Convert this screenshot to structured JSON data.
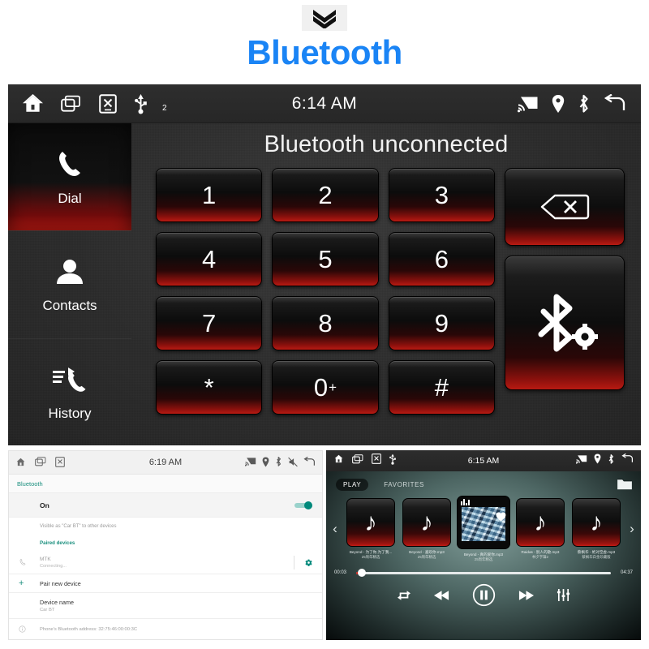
{
  "header": {
    "title": "Bluetooth",
    "chevron_icon": "double-chevron-down-icon",
    "accent_color": "#1a84f5"
  },
  "bt_screen": {
    "statusbar": {
      "time": "6:14 AM",
      "left_icons": [
        "home-icon",
        "recent-apps-icon",
        "close-box-icon",
        "usb-icon"
      ],
      "usb_badge": "2",
      "right_icons": [
        "cast-icon",
        "location-icon",
        "bluetooth-icon",
        "back-icon"
      ]
    },
    "sidebar": {
      "items": [
        {
          "label": "Dial",
          "icon": "phone-handset-icon",
          "selected": true
        },
        {
          "label": "Contacts",
          "icon": "person-icon",
          "selected": false
        },
        {
          "label": "History",
          "icon": "call-history-icon",
          "selected": false
        }
      ]
    },
    "status_text": "Bluetooth unconnected",
    "keypad": [
      {
        "key": "1"
      },
      {
        "key": "2"
      },
      {
        "key": "3"
      },
      {
        "key": "4"
      },
      {
        "key": "5"
      },
      {
        "key": "6"
      },
      {
        "key": "7"
      },
      {
        "key": "8"
      },
      {
        "key": "9"
      },
      {
        "key": "*"
      },
      {
        "key": "0",
        "sup": "+"
      },
      {
        "key": "#"
      }
    ],
    "side_keys": [
      {
        "name": "backspace",
        "icon": "backspace-icon"
      },
      {
        "name": "bluetooth-settings",
        "icon": "bluetooth-gear-icon"
      }
    ]
  },
  "settings_panel": {
    "statusbar": {
      "time": "6:19 AM",
      "left_icons": [
        "home-icon",
        "recent-apps-icon",
        "close-box-icon"
      ],
      "right_icons": [
        "cast-icon",
        "location-icon",
        "bluetooth-icon",
        "mute-icon",
        "back-icon"
      ]
    },
    "title": "Bluetooth",
    "accent_color": "#1a8f7e",
    "toggle_label": "On",
    "toggle_on": true,
    "visible_text": "Visible as \"Car BT\" to other devices",
    "paired_header": "Paired devices",
    "paired_device": {
      "name": "MTK",
      "status": "Connecting...",
      "icon": "phone-handset-icon",
      "gear": "gear-icon"
    },
    "pair_new": "Pair new device",
    "device_name_label": "Device name",
    "device_name_value": "Car BT",
    "address_text": "Phone's Bluetooth address: 32:75:46:00:00:3C"
  },
  "music_panel": {
    "statusbar": {
      "time": "6:15 AM",
      "left_icons": [
        "home-icon",
        "recent-apps-icon",
        "close-box-icon",
        "usb-icon"
      ],
      "right_icons": [
        "cast-icon",
        "location-icon",
        "bluetooth-icon",
        "back-icon"
      ]
    },
    "tabs": [
      {
        "label": "PLAY",
        "active": true
      },
      {
        "label": "FAVORITES",
        "active": false
      }
    ],
    "folder_icon": "folder-icon",
    "carousel": {
      "prev_icon": "chevron-left-icon",
      "next_icon": "chevron-right-icon",
      "items": [
        {
          "title": "Beyond - 为了你,为了我...",
          "subtitle": "25周年精选",
          "art": "note",
          "current": false
        },
        {
          "title": "Beyond - 喜欢你.mp3",
          "subtitle": "25周年精选",
          "art": "note",
          "current": false
        },
        {
          "title": "Beyond - 真的爱你.mp3",
          "subtitle": "25周年精选",
          "art": "album",
          "current": true
        },
        {
          "title": "Raidas - 别人的歌.mp3",
          "subtitle": "林夕字辑2",
          "art": "note",
          "current": false
        },
        {
          "title": "蔡枫华 - 绝对空虚.mp3",
          "subtitle": "蔡枫华白金珍藏版",
          "art": "note",
          "current": false
        }
      ]
    },
    "progress": {
      "elapsed": "00:03",
      "total": "04:37",
      "percent": 1.5
    },
    "controls": [
      {
        "name": "repeat",
        "icon": "repeat-icon"
      },
      {
        "name": "rewind",
        "icon": "rewind-icon"
      },
      {
        "name": "pause",
        "icon": "pause-circle-icon"
      },
      {
        "name": "forward",
        "icon": "fast-forward-icon"
      },
      {
        "name": "equalizer",
        "icon": "equalizer-icon"
      }
    ]
  }
}
